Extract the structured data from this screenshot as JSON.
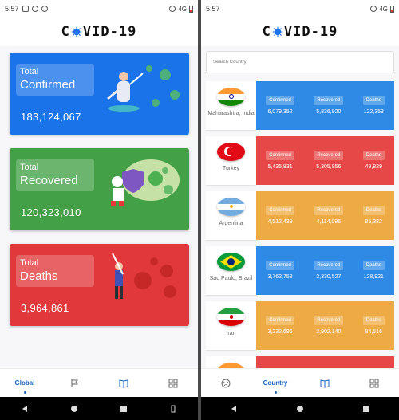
{
  "status": {
    "left_time": "5:57",
    "right_time": "5:57",
    "network": "4G"
  },
  "app": {
    "title_prefix": "C",
    "title_suffix": "VID-19"
  },
  "global_cards": [
    {
      "label_top": "Total",
      "label_main": "Confirmed",
      "value": "183,124,067",
      "color": "#1a73e8"
    },
    {
      "label_top": "Total",
      "label_main": "Recovered",
      "value": "120,323,010",
      "color": "#43a047"
    },
    {
      "label_top": "Total",
      "label_main": "Deaths",
      "value": "3,964,861",
      "color": "#e0383b"
    }
  ],
  "nav_left": {
    "global_label": "Global"
  },
  "nav_right": {
    "country_label": "Country"
  },
  "search": {
    "placeholder": "Search Country"
  },
  "stat_labels": {
    "confirmed": "Confirmed",
    "recovered": "Recovered",
    "deaths": "Deaths"
  },
  "countries": [
    {
      "name": "Maharashtra, India",
      "confirmed": "6,079,352",
      "recovered": "5,836,920",
      "deaths": "122,353",
      "color": "blue",
      "flag": "india"
    },
    {
      "name": "Turkey",
      "confirmed": "5,435,831",
      "recovered": "5,305,856",
      "deaths": "49,829",
      "color": "red",
      "flag": "turkey"
    },
    {
      "name": "Argentina",
      "confirmed": "4,512,439",
      "recovered": "4,114,096",
      "deaths": "95,382",
      "color": "orange",
      "flag": "argentina"
    },
    {
      "name": "Sao Paulo, Brazil",
      "confirmed": "3,762,758",
      "recovered": "3,330,527",
      "deaths": "128,921",
      "color": "blue",
      "flag": "brazil"
    },
    {
      "name": "Iran",
      "confirmed": "3,232,696",
      "recovered": "2,902,140",
      "deaths": "84,516",
      "color": "orange",
      "flag": "iran"
    }
  ]
}
